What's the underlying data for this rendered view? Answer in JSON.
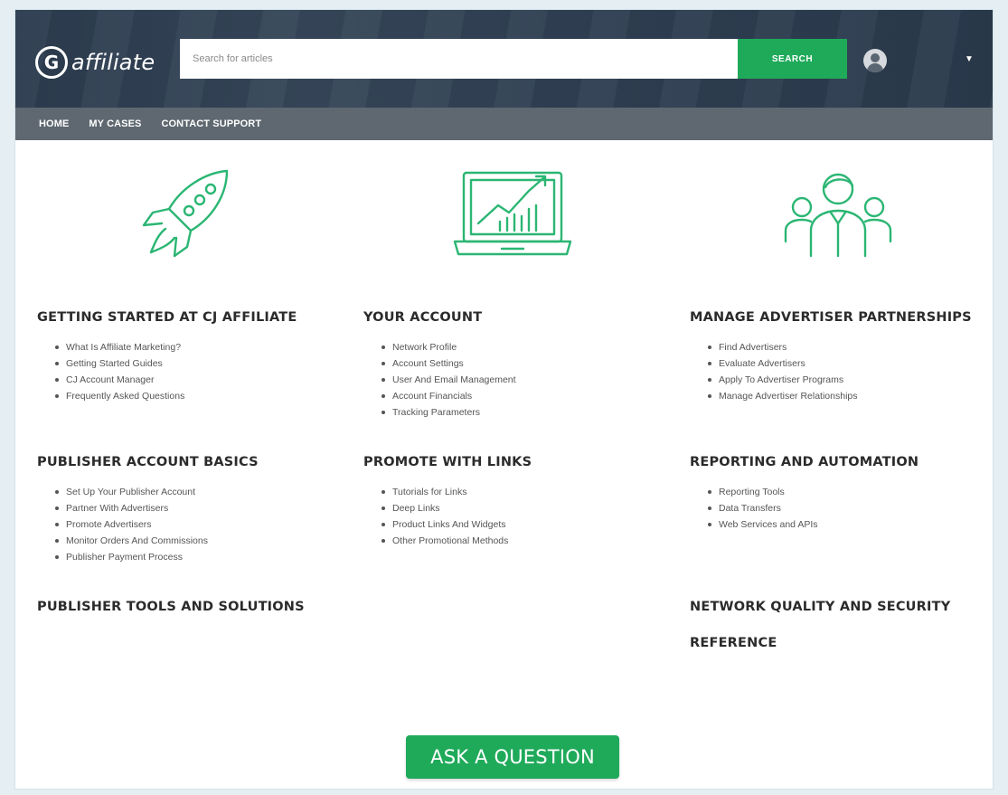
{
  "header": {
    "logo_mark": "G",
    "logo_text": "affiliate",
    "search_placeholder": "Search for articles",
    "search_button": "SEARCH"
  },
  "nav": {
    "items": [
      "HOME",
      "MY CASES",
      "CONTACT SUPPORT"
    ]
  },
  "colors": {
    "accent": "#1faa5a",
    "header_bg": "#2f3f52",
    "nav_bg": "#5f6870"
  },
  "icons": [
    "rocket-icon",
    "laptop-chart-icon",
    "people-icon"
  ],
  "sections": [
    {
      "title": "GETTING STARTED AT CJ AFFILIATE",
      "links": [
        "What Is Affiliate Marketing?",
        "Getting Started Guides",
        "CJ Account Manager",
        "Frequently Asked Questions"
      ]
    },
    {
      "title": "YOUR ACCOUNT",
      "links": [
        "Network Profile",
        "Account Settings",
        "User And Email Management",
        "Account Financials",
        "Tracking Parameters"
      ]
    },
    {
      "title": "MANAGE ADVERTISER PARTNERSHIPS",
      "links": [
        "Find Advertisers",
        "Evaluate Advertisers",
        "Apply To Advertiser Programs",
        "Manage Advertiser Relationships"
      ]
    },
    {
      "title": "PUBLISHER ACCOUNT BASICS",
      "links": [
        "Set Up Your Publisher Account",
        "Partner With Advertisers",
        "Promote Advertisers",
        "Monitor Orders And Commissions",
        "Publisher Payment Process"
      ]
    },
    {
      "title": "PROMOTE WITH LINKS",
      "links": [
        "Tutorials for Links",
        "Deep Links",
        "Product Links And Widgets",
        "Other Promotional Methods"
      ]
    },
    {
      "title": "REPORTING AND AUTOMATION",
      "links": [
        "Reporting Tools",
        "Data Transfers",
        "Web Services and APIs"
      ]
    },
    {
      "title": "PUBLISHER TOOLS AND SOLUTIONS",
      "links": []
    },
    {
      "title": "NETWORK QUALITY AND SECURITY",
      "links": []
    },
    {
      "title": "REFERENCE",
      "links": []
    }
  ],
  "ask_button": "ASK A QUESTION"
}
